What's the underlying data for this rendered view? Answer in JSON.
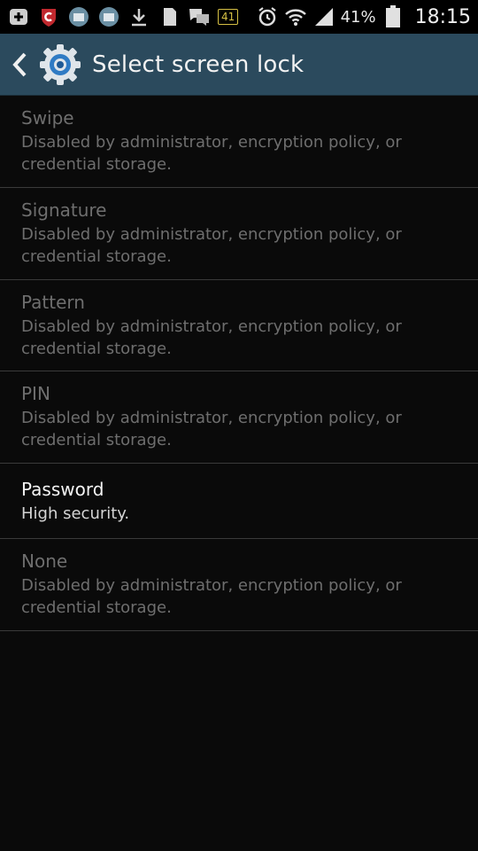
{
  "status_bar": {
    "notification_count": "41",
    "battery_percent": "41%",
    "time": "18:15"
  },
  "header": {
    "title": "Select screen lock"
  },
  "options": [
    {
      "label": "Swipe",
      "summary": "Disabled by administrator, encryption policy, or credential storage.",
      "enabled": false
    },
    {
      "label": "Signature",
      "summary": "Disabled by administrator, encryption policy, or credential storage.",
      "enabled": false
    },
    {
      "label": "Pattern",
      "summary": "Disabled by administrator, encryption policy, or credential storage.",
      "enabled": false
    },
    {
      "label": "PIN",
      "summary": "Disabled by administrator, encryption policy, or credential storage.",
      "enabled": false
    },
    {
      "label": "Password",
      "summary": "High security.",
      "enabled": true
    },
    {
      "label": "None",
      "summary": "Disabled by administrator, encryption policy, or credential storage.",
      "enabled": false
    }
  ],
  "colors": {
    "action_bar": "#2b4a5d",
    "background": "#0a0a0a",
    "disabled_text": "#6e6e6e"
  }
}
